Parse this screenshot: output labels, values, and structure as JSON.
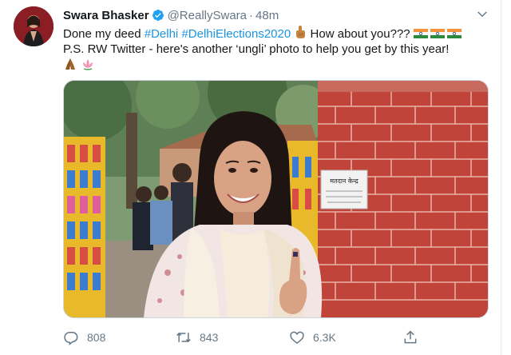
{
  "tweet": {
    "author_name": "Swara Bhasker",
    "handle": "@ReallySwara",
    "separator": "·",
    "time": "48m",
    "text_line1_pre": "Done my deed ",
    "hashtags": [
      "#Delhi",
      "#DelhiElections2020"
    ],
    "text_line1_post": " How about you???",
    "text_line2": "P.S. RW Twitter - here's another ‘ungli’ photo to help you get by this year!",
    "emojis": {
      "finger": "index-finger-up-emoji",
      "flag": "india-flag-emoji",
      "folded_hands": "folded-hands-emoji",
      "lotus": "lotus-emoji"
    },
    "photo_sign_text": "मतदान केन्द्र",
    "colors": {
      "hashtag": "#1b95e0",
      "verified": "#1da1f2",
      "secondary_text": "#657786",
      "brick": "#c0443a"
    }
  },
  "actions": {
    "reply_count": "808",
    "retweet_count": "843",
    "like_count": "6.3K",
    "share_icon": "share-icon"
  }
}
